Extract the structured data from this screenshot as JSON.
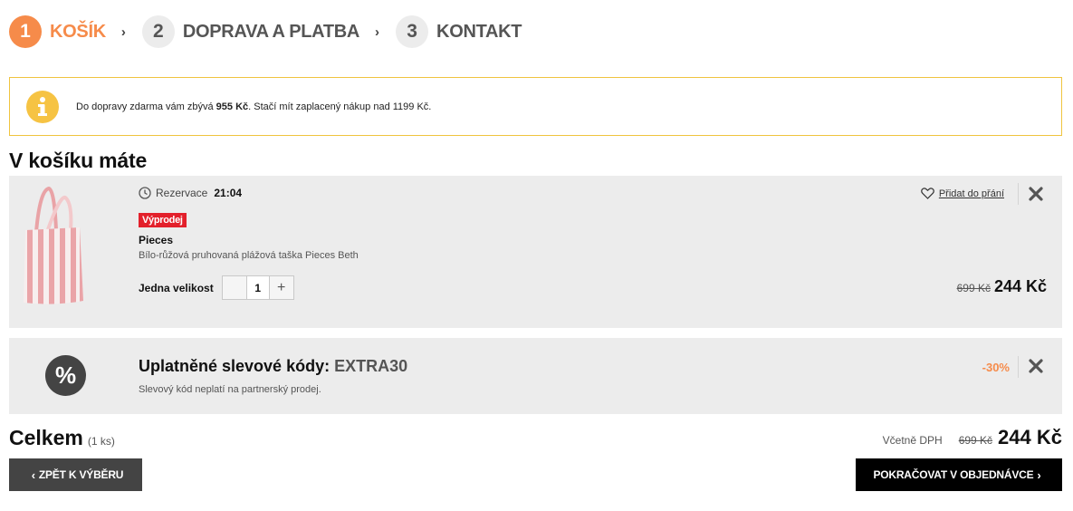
{
  "steps": [
    {
      "num": "1",
      "label": "KOŠÍK"
    },
    {
      "num": "2",
      "label": "DOPRAVA A PLATBA"
    },
    {
      "num": "3",
      "label": "KONTAKT"
    }
  ],
  "info": {
    "before": "Do dopravy zdarma vám zbývá ",
    "amount": "955 Kč",
    "after": ". Stačí mít zaplacený nákup nad 1199 Kč."
  },
  "heading": "V košíku máte",
  "item": {
    "reservation_label": "Rezervace",
    "reservation_time": "21:04",
    "badge": "Výprodej",
    "brand": "Pieces",
    "name": "Bílo-růžová pruhovaná plážová taška Pieces Beth",
    "size_label": "Jedna velikost",
    "quantity": "1",
    "wishlist_label": "Přidat do přání",
    "price_old": "699 Kč",
    "price_new": "244 Kč"
  },
  "discount": {
    "icon": "%",
    "title": "Uplatněné slevové kódy: ",
    "code": "EXTRA30",
    "note": "Slevový kód neplatí na partnerský prodej.",
    "percent": "-30%"
  },
  "total": {
    "label": "Celkem",
    "count": "(1 ks)",
    "vat_label": "Včetně DPH",
    "price_old": "699 Kč",
    "price_new": "244 Kč"
  },
  "buttons": {
    "back": "ZPĚT K VÝBĚRU",
    "next": "POKRAČOVAT V OBJEDNÁVCE"
  },
  "colors": {
    "accent": "#f68b4a",
    "info_border": "#f0c43f",
    "badge": "#e3202b"
  }
}
